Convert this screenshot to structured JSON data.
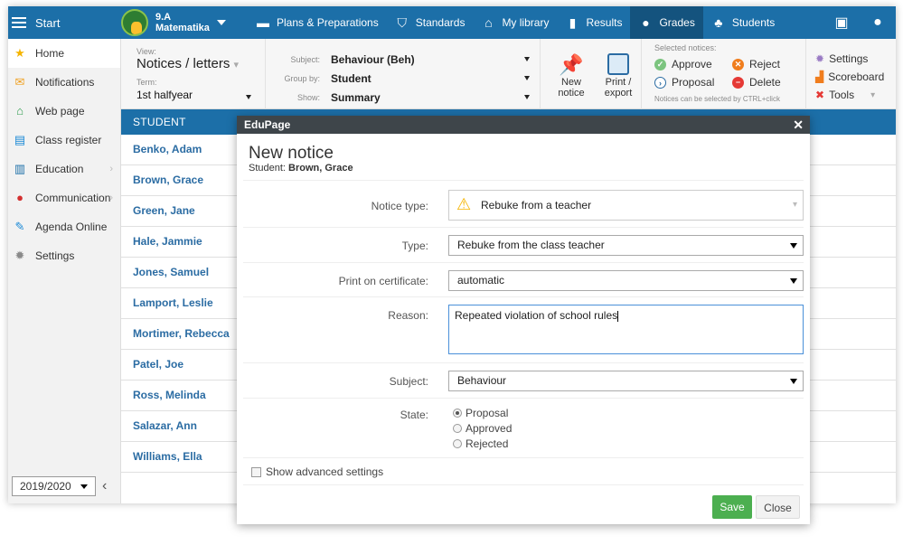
{
  "nav": {
    "start": "Start",
    "class_name": "9.A",
    "class_subject": "Matematika",
    "items": [
      {
        "label": "Plans & Preparations",
        "icon": "folder-icon"
      },
      {
        "label": "Standards",
        "icon": "shield-icon"
      },
      {
        "label": "My library",
        "icon": "library-icon"
      },
      {
        "label": "Results",
        "icon": "bar-chart-icon"
      },
      {
        "label": "Grades",
        "icon": "grades-icon"
      },
      {
        "label": "Students",
        "icon": "students-icon"
      }
    ]
  },
  "sidebar": {
    "items": [
      {
        "label": "Home",
        "icon": "star-icon"
      },
      {
        "label": "Notifications",
        "icon": "envelope-icon"
      },
      {
        "label": "Web page",
        "icon": "house-icon"
      },
      {
        "label": "Class register",
        "icon": "register-icon"
      },
      {
        "label": "Education",
        "icon": "book-icon"
      },
      {
        "label": "Communication",
        "icon": "chat-icon"
      },
      {
        "label": "Agenda Online",
        "icon": "pencil-icon"
      },
      {
        "label": "Settings",
        "icon": "gear-icon"
      }
    ],
    "year": "2019/2020"
  },
  "toolbar": {
    "view_label": "View:",
    "view_value": "Notices / letters",
    "term_label": "Term:",
    "term_value": "1st halfyear",
    "subject_label": "Subject:",
    "subject_value": "Behaviour (Beh)",
    "groupby_label": "Group by:",
    "groupby_value": "Student",
    "show_label": "Show:",
    "show_value": "Summary",
    "new_notice": "New notice",
    "print_export": "Print / export",
    "selected_notices": "Selected notices:",
    "approve": "Approve",
    "reject": "Reject",
    "proposal": "Proposal",
    "delete": "Delete",
    "hint": "Notices can be selected by CTRL+click",
    "settings": "Settings",
    "scoreboard": "Scoreboard",
    "tools": "Tools"
  },
  "list": {
    "header": "Student",
    "students": [
      "Benko, Adam",
      "Brown, Grace",
      "Green, Jane",
      "Hale, Jammie",
      "Jones, Samuel",
      "Lamport, Leslie",
      "Mortimer, Rebecca",
      "Patel, Joe",
      "Ross, Melinda",
      "Salazar, Ann",
      "Williams, Ella"
    ]
  },
  "modal": {
    "header": "EduPage",
    "title": "New notice",
    "student_prefix": "Student:",
    "student_name": "Brown, Grace",
    "notice_type_label": "Notice type:",
    "notice_type_value": "Rebuke from a teacher",
    "type_label": "Type:",
    "type_value": "Rebuke from the class teacher",
    "print_label": "Print on certificate:",
    "print_value": "automatic",
    "reason_label": "Reason:",
    "reason_value": "Repeated violation of school rules",
    "subject_label": "Subject:",
    "subject_value": "Behaviour",
    "state_label": "State:",
    "states": [
      "Proposal",
      "Approved",
      "Rejected"
    ],
    "selected_state": "Proposal",
    "advanced": "Show advanced settings",
    "save": "Save",
    "close": "Close"
  },
  "colors": {
    "nav_blue": "#1c6fa8",
    "save_green": "#4caf50",
    "modal_header": "#3e454a"
  }
}
